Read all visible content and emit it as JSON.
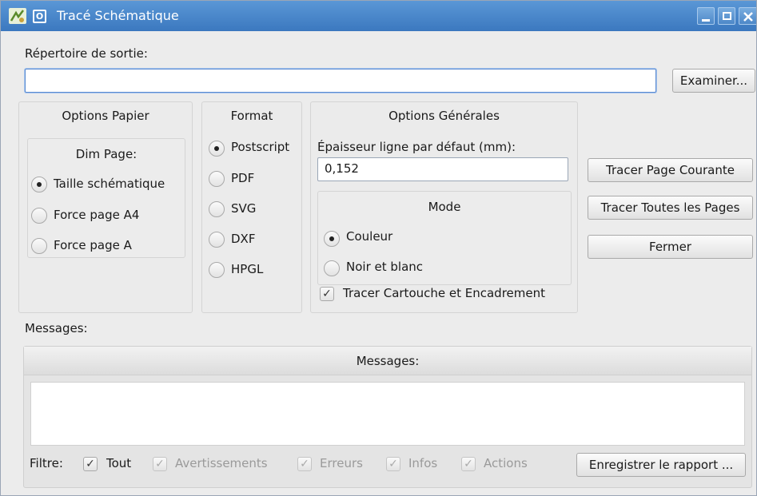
{
  "window": {
    "title": "Tracé Schématique",
    "menu_glyph": "O"
  },
  "output": {
    "label": "Répertoire de sortie:",
    "value": "",
    "browse_label": "Examiner..."
  },
  "paper": {
    "title": "Options Papier",
    "page_size_title": "Dim Page:",
    "options": [
      {
        "label": "Taille schématique",
        "selected": true
      },
      {
        "label": "Force page A4",
        "selected": false
      },
      {
        "label": "Force page A",
        "selected": false
      }
    ]
  },
  "format": {
    "title": "Format",
    "options": [
      {
        "label": "Postscript",
        "selected": true
      },
      {
        "label": "PDF",
        "selected": false
      },
      {
        "label": "SVG",
        "selected": false
      },
      {
        "label": "DXF",
        "selected": false
      },
      {
        "label": "HPGL",
        "selected": false
      }
    ]
  },
  "general": {
    "title": "Options Générales",
    "line_width_label": "Épaisseur ligne par défaut (mm):",
    "line_width_value": "0,152",
    "mode_title": "Mode",
    "mode_options": [
      {
        "label": "Couleur",
        "selected": true
      },
      {
        "label": "Noir et blanc",
        "selected": false
      }
    ],
    "frame_ref_label": "Tracer Cartouche et Encadrement",
    "frame_ref_checked": true
  },
  "actions": {
    "plot_current": "Tracer Page Courante",
    "plot_all": "Tracer Toutes les Pages",
    "close": "Fermer"
  },
  "messages": {
    "label": "Messages:",
    "panel_header": "Messages:",
    "filter_label": "Filtre:",
    "filters": [
      {
        "label": "Tout",
        "checked": true,
        "enabled": true
      },
      {
        "label": "Avertissements",
        "checked": true,
        "enabled": false
      },
      {
        "label": "Erreurs",
        "checked": true,
        "enabled": false
      },
      {
        "label": "Infos",
        "checked": true,
        "enabled": false
      },
      {
        "label": "Actions",
        "checked": true,
        "enabled": false
      }
    ],
    "save_report": "Enregistrer le rapport ..."
  }
}
